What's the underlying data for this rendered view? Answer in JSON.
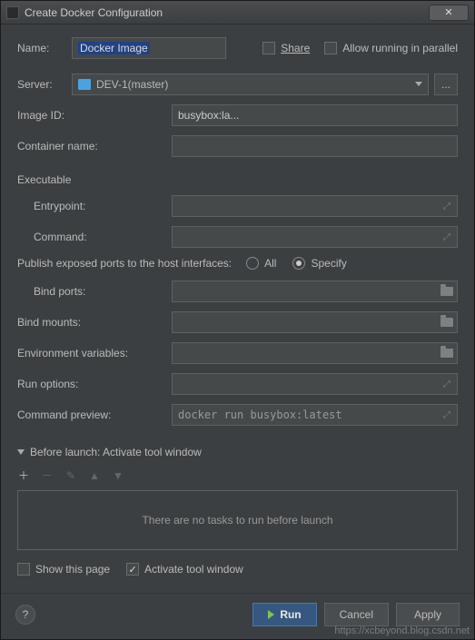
{
  "window": {
    "title": "Create Docker Configuration"
  },
  "top": {
    "name_label": "Name:",
    "name_value": "Docker Image",
    "share_label": "Share",
    "parallel_label": "Allow running in parallel"
  },
  "server": {
    "label": "Server:",
    "value": "DEV-1(master)",
    "ellipsis": "..."
  },
  "fields": {
    "image_id_label": "Image ID:",
    "image_id_value": "busybox:la...",
    "container_name_label": "Container name:",
    "executable_header": "Executable",
    "entrypoint_label": "Entrypoint:",
    "command_label": "Command:",
    "ports_header": "Publish exposed ports to the host interfaces:",
    "radio_all": "All",
    "radio_specify": "Specify",
    "bind_ports_label": "Bind ports:",
    "bind_mounts_label": "Bind mounts:",
    "env_label": "Environment variables:",
    "run_options_label": "Run options:",
    "cmd_preview_label": "Command preview:",
    "cmd_preview_value": "docker run busybox:latest"
  },
  "before_launch": {
    "header": "Before launch: Activate tool window",
    "empty_text": "There are no tasks to run before launch",
    "show_page_label": "Show this page",
    "activate_label": "Activate tool window"
  },
  "buttons": {
    "run": "Run",
    "cancel": "Cancel",
    "apply": "Apply",
    "help": "?"
  },
  "watermark": "https://xcbeyond.blog.csdn.net"
}
